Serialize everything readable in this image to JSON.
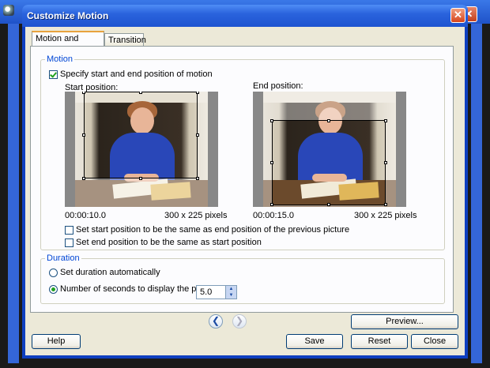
{
  "dialog": {
    "title": "Customize Motion",
    "close_glyph": "✕"
  },
  "background_window": {
    "close_glyph": "✕"
  },
  "tabs": [
    {
      "label": "Motion and Duration",
      "active": true
    },
    {
      "label": "Transition",
      "active": false
    }
  ],
  "motion": {
    "group_label": "Motion",
    "specify_label": "Specify start and end position of motion",
    "specify_checked": true,
    "start": {
      "label": "Start position:",
      "time": "00:00:10.0",
      "size": "300 x 225 pixels"
    },
    "end": {
      "label": "End position:",
      "time": "00:00:15.0",
      "size": "300 x 225 pixels"
    },
    "option_start_same": "Set start position to be the same as end position of the previous picture",
    "option_end_same": "Set end position to be the same as start position"
  },
  "duration": {
    "group_label": "Duration",
    "auto_label": "Set duration automatically",
    "seconds_label": "Number of seconds to display the picture",
    "seconds_value": "5.0",
    "selected": "seconds"
  },
  "nav": {
    "prev_glyph": "❮",
    "next_glyph": "❯"
  },
  "buttons": {
    "preview": "Preview...",
    "help": "Help",
    "save": "Save",
    "reset": "Reset",
    "close": "Close"
  },
  "colors": {
    "title_bar": "#2a63dd",
    "group_label": "#0046d5",
    "check_green": "#21a121"
  }
}
